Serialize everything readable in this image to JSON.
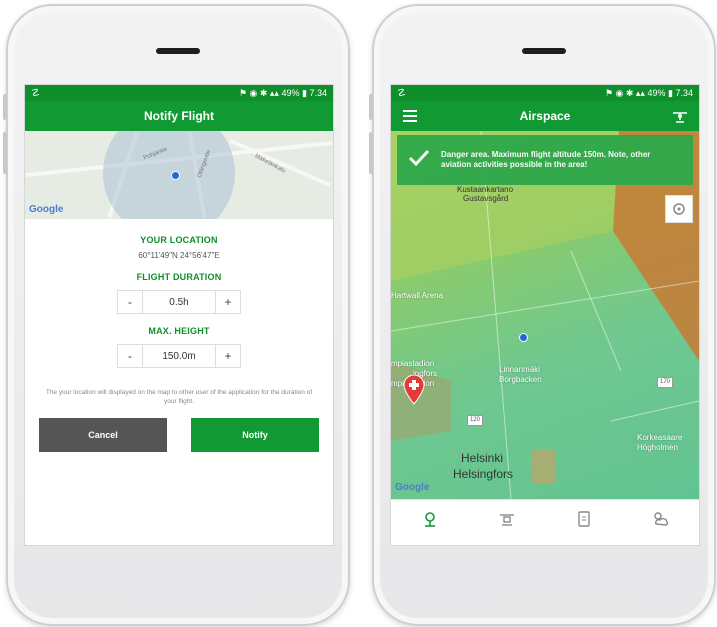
{
  "left_screen": {
    "status": {
      "time": "7.34",
      "battery": "49%"
    },
    "title": "Notify Flight",
    "map_attribution": "Google",
    "streets": [
      "Pohjantie",
      "Ottingentie",
      "Mäkelänkatu"
    ],
    "location_label": "YOUR LOCATION",
    "location_value": "60°11'49\"N 24°56'47\"E",
    "duration_label": "FLIGHT DURATION",
    "duration_value": "0.5h",
    "height_label": "MAX. HEIGHT",
    "height_value": "150.0m",
    "minus": "-",
    "plus": "+",
    "note": "The your location will displayed on the map to other user of the application for the duration of your flight.",
    "cancel_label": "Cancel",
    "notify_label": "Notify"
  },
  "right_screen": {
    "status": {
      "time": "7.34",
      "battery": "49%"
    },
    "title": "Airspace",
    "banner_text": "Danger area. Maximum flight altitude 150m. Note, other aviation activities possible in the area!",
    "map_attribution": "Google",
    "map_labels": {
      "kustaankartano": "Kustaankartano",
      "gustavsgard": "Gustavsgård",
      "hartwall": "Hartwall Arena",
      "linnanmaki": "Linnanmäki",
      "borgbacken": "Borgbacken",
      "olympiastadion": "mpiastadion",
      "ingfors": "ingfors",
      "stadion": "mpiastadion",
      "helsinki": "Helsinki",
      "helsingfors": "Helsingfors",
      "korkeasaari": "Korkeasaare",
      "hogholmen": "Högholmen",
      "road_170": "170",
      "road_120": "120"
    }
  },
  "colors": {
    "primary_green": "#119a33",
    "danger_orange": "#c97a35",
    "cancel_gray": "#555555",
    "marker_red": "#e43a3a"
  }
}
